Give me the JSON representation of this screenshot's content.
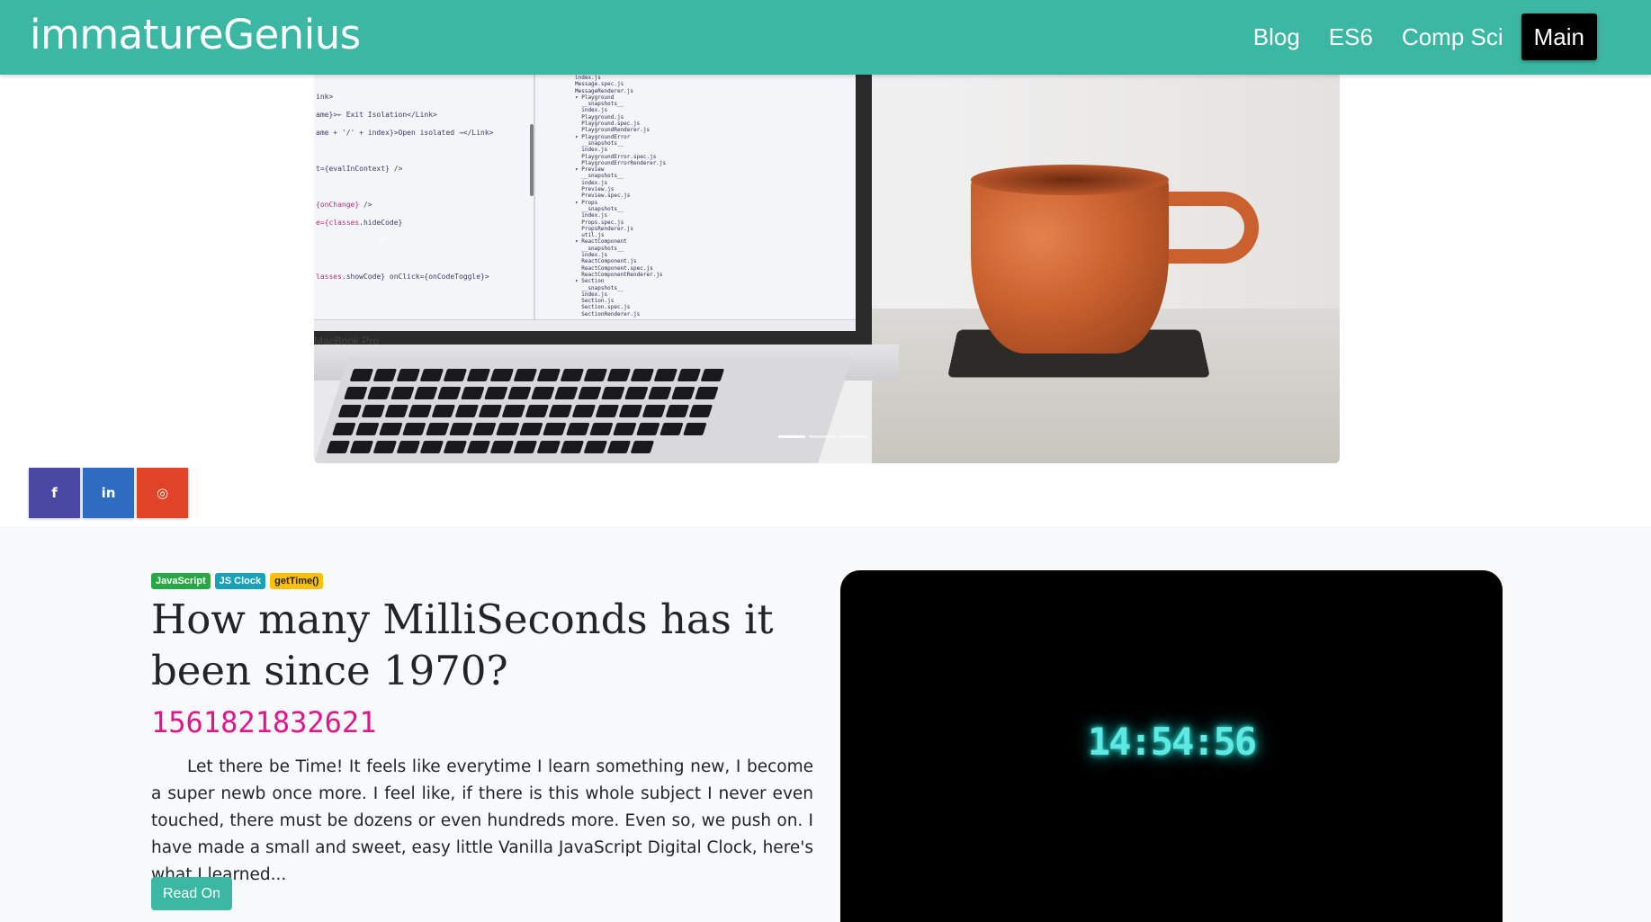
{
  "navbar": {
    "brand": "immatureGenius",
    "links": [
      {
        "label": "Blog"
      },
      {
        "label": "ES6"
      },
      {
        "label": "Comp Sci"
      },
      {
        "label": "Main"
      }
    ]
  },
  "hero": {
    "image_description_label": "MacBook Pro",
    "indicators": 3,
    "active_indicator": 1
  },
  "social": [
    {
      "icon": "facebook-icon",
      "glyph": "f"
    },
    {
      "icon": "linkedin-icon",
      "glyph": "in"
    },
    {
      "icon": "instagram-icon",
      "glyph": "◎"
    }
  ],
  "article": {
    "tags": [
      {
        "label": "JavaScript"
      },
      {
        "label": "JS Clock"
      },
      {
        "label": "getTime()"
      }
    ],
    "title": "How many MilliSeconds has it been since 1970?",
    "milliseconds": "1561821832621",
    "excerpt": "Let there be Time! It feels like everytime I learn something new, I become a super newb once more. I feel like, if there is this whole subject I never even touched, there must be dozens or even hundreds more. Even so, we push on. I have made a small and sweet, easy little Vanilla JavaScript Digital Clock, here's what I learned...",
    "read_more": "Read On"
  },
  "clock": {
    "time": "14:54:56"
  },
  "colors": {
    "navbar": "#3cb7a4",
    "active_nav": "#000000",
    "millis": "#e0158a",
    "clock_glow": "#5fe9e2"
  }
}
